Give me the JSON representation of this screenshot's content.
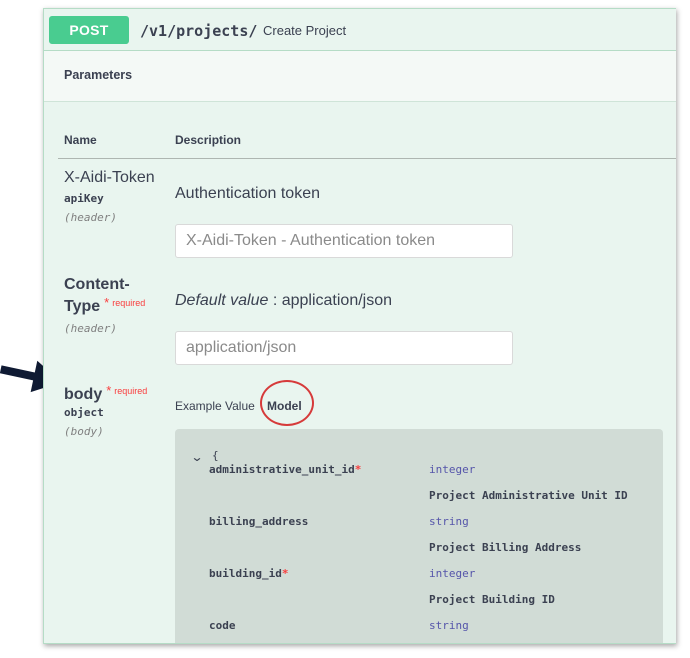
{
  "endpoint": {
    "method": "POST",
    "path": "/v1/projects/",
    "summary": "Create Project"
  },
  "parameters": {
    "title": "Parameters",
    "col_name": "Name",
    "col_description": "Description",
    "required_mark": "*",
    "required_label": "required",
    "items": [
      {
        "name": "X-Aidi-Token",
        "type": "apiKey",
        "in": "(header)",
        "description": "Authentication token",
        "input_placeholder": "X-Aidi-Token - Authentication token"
      },
      {
        "name_line1": "Content-",
        "name_line2": "Type",
        "in": "(header)",
        "default_label": "Default value",
        "default_sep": " : application/json",
        "input_placeholder": "application/json"
      },
      {
        "name": "body",
        "type": "object",
        "in": "(body)"
      }
    ]
  },
  "tabs": {
    "example_value": "Example Value",
    "model": "Model"
  },
  "model": {
    "chevron": "⌄",
    "open_brace": "{",
    "fields": [
      {
        "name": "administrative_unit_id",
        "required": true,
        "type": "integer",
        "description": "Project Administrative Unit ID"
      },
      {
        "name": "billing_address",
        "required": false,
        "type": "string",
        "description": "Project Billing Address"
      },
      {
        "name": "building_id",
        "required": true,
        "type": "integer",
        "description": "Project Building ID"
      },
      {
        "name": "code",
        "required": false,
        "type": "string",
        "description": ""
      }
    ]
  },
  "colors": {
    "post_badge": "#49cc90",
    "panel_bg": "#e9f5ef",
    "required_red": "#f93e3e",
    "annotation_circle": "#d63a3a",
    "annotation_arrow": "#0f1a33"
  }
}
